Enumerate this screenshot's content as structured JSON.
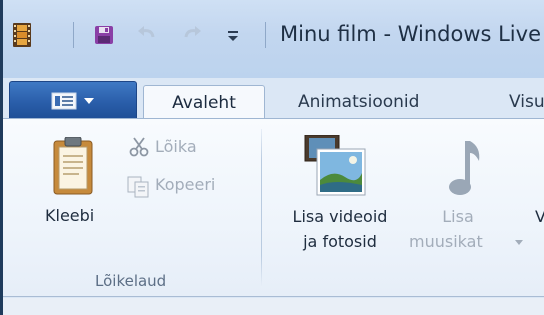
{
  "window": {
    "title": "Minu film - Windows Live"
  },
  "quick_access": {
    "icons": [
      "film-app-icon",
      "save-icon",
      "undo-icon",
      "redo-icon",
      "customize-dropdown-icon"
    ]
  },
  "tabs": [
    {
      "label": "Avaleht",
      "active": true
    },
    {
      "label": "Animatsioonid",
      "active": false
    },
    {
      "label": "Visu",
      "active": false
    }
  ],
  "ribbon": {
    "clipboard": {
      "paste_label": "Kleebi",
      "cut_label": "Lõika",
      "copy_label": "Kopeeri",
      "group_label": "Lõikelaud"
    },
    "add": {
      "add_videos_line1": "Lisa videoid",
      "add_videos_line2": "ja fotosid",
      "add_music_line1": "Lisa",
      "add_music_line2": "muusikat",
      "partial_label": "V"
    }
  },
  "colors": {
    "titlebar": "#c2d6ef",
    "app_menu": "#2a5eaa",
    "disabled_text": "#a3adba"
  }
}
